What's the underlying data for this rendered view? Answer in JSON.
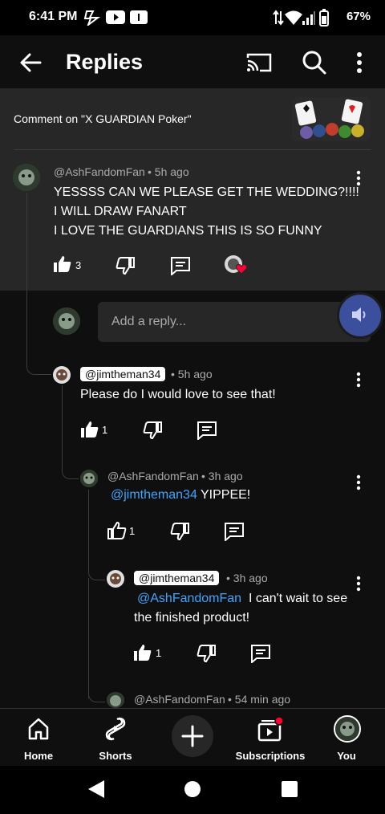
{
  "status": {
    "time": "6:41 PM",
    "battery": "67%"
  },
  "appbar": {
    "title": "Replies"
  },
  "context": {
    "label": "Comment on \"X GUARDIAN Poker\""
  },
  "top_comment": {
    "author": "@AshFandomFan",
    "time": "• 5h ago",
    "lines": [
      "YESSSS CAN WE PLEASE GET THE WEDDING?!!!!",
      "I WILL DRAW FANART",
      "I LOVE THE GUARDIANS THIS IS SO FUNNY"
    ],
    "likes": "3"
  },
  "reply_input": {
    "placeholder": "Add a reply..."
  },
  "replies": [
    {
      "author": "@jimtheman34",
      "time": "• 5h ago",
      "text": "Please do I would love to see that!",
      "likes": "1"
    },
    {
      "author": "@AshFandomFan",
      "time": "• 3h ago",
      "mention": "@jimtheman34",
      "text": " YIPPEE!",
      "likes": "1"
    },
    {
      "author": "@jimtheman34",
      "time": "• 3h ago",
      "mention": "@AshFandomFan",
      "text": "  I can't wait to see",
      "text2": "the finished product!",
      "likes": "1"
    },
    {
      "author": "@AshFandomFan",
      "time": "• 54 min ago"
    }
  ],
  "nav": {
    "home": "Home",
    "shorts": "Shorts",
    "subscriptions": "Subscriptions",
    "you": "You"
  },
  "colors": {
    "accent_mention": "#3ea6ff",
    "notification_red": "#ff0033"
  }
}
